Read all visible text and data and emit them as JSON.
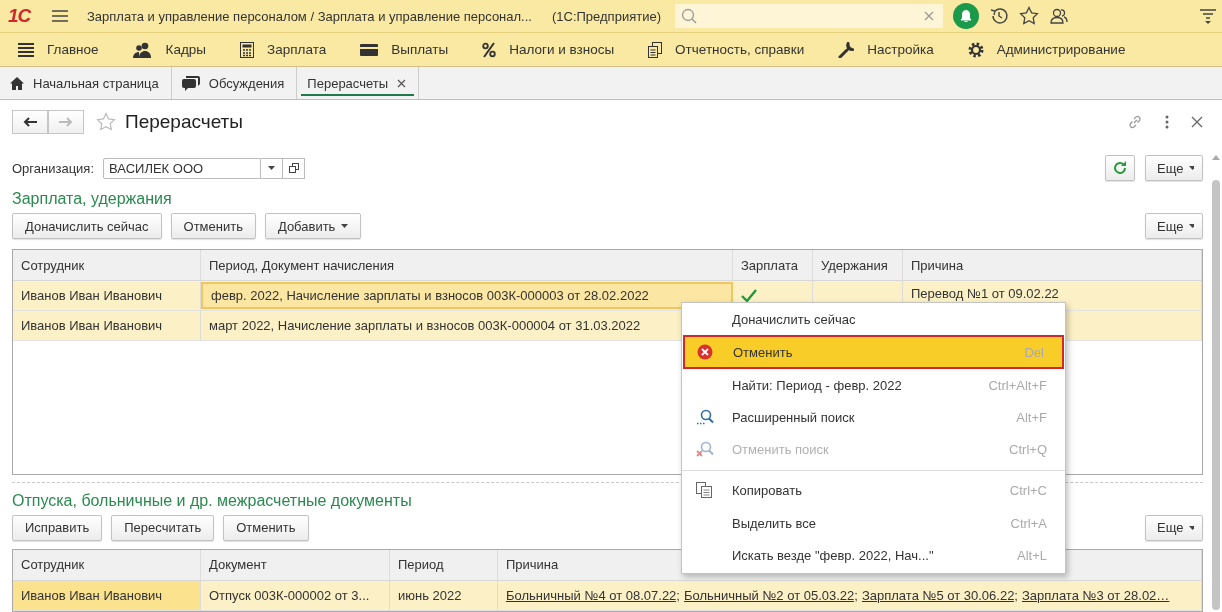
{
  "title_bar": {
    "logo": "1С",
    "title": "Зарплата и управление персоналом / Зарплата и управление персонал...",
    "app": "(1С:Предприятие)"
  },
  "sections": [
    {
      "label": "Главное"
    },
    {
      "label": "Кадры"
    },
    {
      "label": "Зарплата"
    },
    {
      "label": "Выплаты"
    },
    {
      "label": "Налоги и взносы"
    },
    {
      "label": "Отчетность, справки"
    },
    {
      "label": "Настройка"
    },
    {
      "label": "Администрирование"
    }
  ],
  "tabs": [
    {
      "label": "Начальная страница",
      "selected": false,
      "closable": false
    },
    {
      "label": "Обсуждения",
      "selected": false,
      "closable": false
    },
    {
      "label": "Перерасчеты",
      "selected": true,
      "closable": true
    }
  ],
  "form": {
    "title": "Перерасчеты",
    "organization": {
      "label": "Организация:",
      "value": "ВАСИЛЕК ООО"
    },
    "more_button": "Еще"
  },
  "salary_section": {
    "title": "Зарплата, удержания",
    "buttons": [
      {
        "label": "Доначислить сейчас",
        "dropdown": false
      },
      {
        "label": "Отменить",
        "dropdown": false
      },
      {
        "label": "Добавить",
        "dropdown": true
      }
    ],
    "more_button": "Еще",
    "columns": [
      "Сотрудник",
      "Период, Документ начисления",
      "Зарплата",
      "Удержания",
      "Причина"
    ],
    "rows": [
      {
        "selected": true,
        "focused": true,
        "employee": "Иванов Иван Иванович",
        "document": "февр. 2022, Начисление зарплаты и взносов 003К-000003 от 28.02.2022",
        "salary": true,
        "reason": "Перевод №1 от 09.02.22"
      },
      {
        "selected": true,
        "focused": false,
        "employee": "Иванов Иван Иванович",
        "document": "март 2022, Начисление зарплаты и взносов 003К-000004 от 31.03.2022"
      }
    ]
  },
  "documents_section": {
    "title": "Отпуска, больничные и др. межрасчетные документы",
    "buttons": [
      {
        "label": "Исправить",
        "dropdown": false
      },
      {
        "label": "Пересчитать",
        "dropdown": false
      },
      {
        "label": "Отменить",
        "dropdown": false
      }
    ],
    "more_button": "Еще",
    "columns": [
      "Сотрудник",
      "Документ",
      "Период",
      "Причина"
    ],
    "rows": [
      {
        "selected": true,
        "employee": "Иванов Иван Иванович",
        "document": "Отпуск 003К-000002 от 3...",
        "period": "июнь 2022",
        "reasons": [
          "Больничный №4 от 08.07.22;",
          "Больничный №2 от 05.03.22;",
          "Зарплата №5 от 30.06.22;",
          "Зарплата №3 от 28.02…"
        ]
      }
    ]
  },
  "context_menu": {
    "items": [
      {
        "label": "Доначислить сейчас",
        "selected": false,
        "disabled": false,
        "separator_before": false
      },
      {
        "label": "Отменить",
        "shortcut": "Del",
        "selected": true,
        "disabled": false,
        "separator_before": false
      },
      {
        "label": "Найти: Период - февр. 2022",
        "shortcut": "Ctrl+Alt+F",
        "selected": false,
        "disabled": false,
        "separator_before": false
      },
      {
        "label": "Расширенный поиск",
        "shortcut": "Alt+F",
        "selected": false,
        "disabled": false,
        "separator_before": false
      },
      {
        "label": "Отменить поиск",
        "shortcut": "Ctrl+Q",
        "selected": false,
        "disabled": true,
        "separator_before": false
      },
      {
        "label": "Копировать",
        "shortcut": "Ctrl+C",
        "selected": false,
        "disabled": false,
        "separator_before": true
      },
      {
        "label": "Выделить все",
        "shortcut": "Ctrl+A",
        "selected": false,
        "disabled": false,
        "separator_before": false
      },
      {
        "label": "Искать везде \"февр. 2022, Нач...\"",
        "shortcut": "Alt+L",
        "selected": false,
        "disabled": false,
        "separator_before": false
      }
    ]
  }
}
